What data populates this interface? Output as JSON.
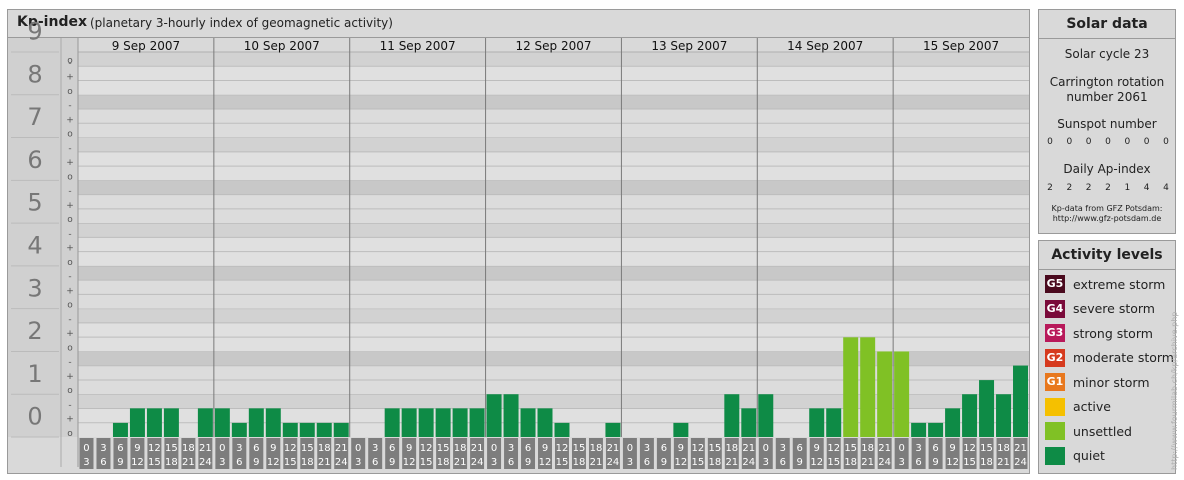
{
  "header": {
    "title": "Kp-index",
    "subtitle": "(planetary 3-hourly index of geomagnetic activity)"
  },
  "chart_data": {
    "type": "bar",
    "title": "Kp-index",
    "subtitle": "(planetary 3-hourly index of geomagnetic activity)",
    "y_major_ticks": [
      "0",
      "1",
      "2",
      "3",
      "4",
      "5",
      "6",
      "7",
      "8",
      "9"
    ],
    "y_minor_ticks": [
      "-",
      "o",
      "+"
    ],
    "ylim": [
      0,
      9
    ],
    "days": [
      "9 Sep 2007",
      "10 Sep 2007",
      "11 Sep 2007",
      "12 Sep 2007",
      "13 Sep 2007",
      "14 Sep 2007",
      "15 Sep 2007"
    ],
    "interval_start_labels": [
      "0",
      "3",
      "6",
      "9",
      "12",
      "15",
      "18",
      "21"
    ],
    "interval_end_labels": [
      "3",
      "6",
      "9",
      "12",
      "15",
      "18",
      "21",
      "24"
    ],
    "values": [
      [
        0.0,
        0.0,
        0.33,
        0.67,
        0.67,
        0.67,
        0.0,
        0.67
      ],
      [
        0.67,
        0.33,
        0.67,
        0.67,
        0.33,
        0.33,
        0.33,
        0.33
      ],
      [
        0.0,
        0.0,
        0.67,
        0.67,
        0.67,
        0.67,
        0.67,
        0.67
      ],
      [
        1.0,
        1.0,
        0.67,
        0.67,
        0.33,
        0.0,
        0.0,
        0.33
      ],
      [
        0.0,
        0.0,
        0.0,
        0.33,
        0.0,
        0.0,
        1.0,
        0.67
      ],
      [
        1.0,
        0.0,
        0.0,
        0.67,
        0.67,
        2.33,
        2.33,
        2.0
      ],
      [
        2.0,
        0.33,
        0.33,
        0.67,
        1.0,
        1.33,
        1.0,
        1.67
      ]
    ],
    "colors": {
      "quiet": "#0e8b46",
      "unsettled": "#80c125"
    },
    "unsettled_threshold": 2,
    "grid": true
  },
  "solar": {
    "title": "Solar data",
    "cycle": "Solar cycle 23",
    "carrington_line1": "Carrington rotation",
    "carrington_line2": "number 2061",
    "sunspot_label": "Sunspot number",
    "sunspot_values": [
      "0",
      "0",
      "0",
      "0",
      "0",
      "0",
      "0"
    ],
    "ap_label": "Daily Ap-index",
    "ap_values": [
      "2",
      "2",
      "2",
      "2",
      "1",
      "4",
      "4"
    ],
    "source_line1": "Kp-data from GFZ Potsdam:",
    "source_line2": "http://www.gfz-potsdam.de"
  },
  "activity": {
    "title": "Activity levels",
    "levels": [
      {
        "code": "G5",
        "label": "extreme storm",
        "color": "#4a0a1e"
      },
      {
        "code": "G4",
        "label": "severe storm",
        "color": "#7a0a3a"
      },
      {
        "code": "G3",
        "label": "strong storm",
        "color": "#b8195a"
      },
      {
        "code": "G2",
        "label": "moderate storm",
        "color": "#d63a1e"
      },
      {
        "code": "G1",
        "label": "minor storm",
        "color": "#e8781e"
      },
      {
        "code": "",
        "label": "active",
        "color": "#f5c000"
      },
      {
        "code": "",
        "label": "unsettled",
        "color": "#80c125"
      },
      {
        "code": "",
        "label": "quiet",
        "color": "#0e8b46"
      }
    ]
  },
  "watermark": "http://www.fourmilab.ch/kp/archive.php"
}
